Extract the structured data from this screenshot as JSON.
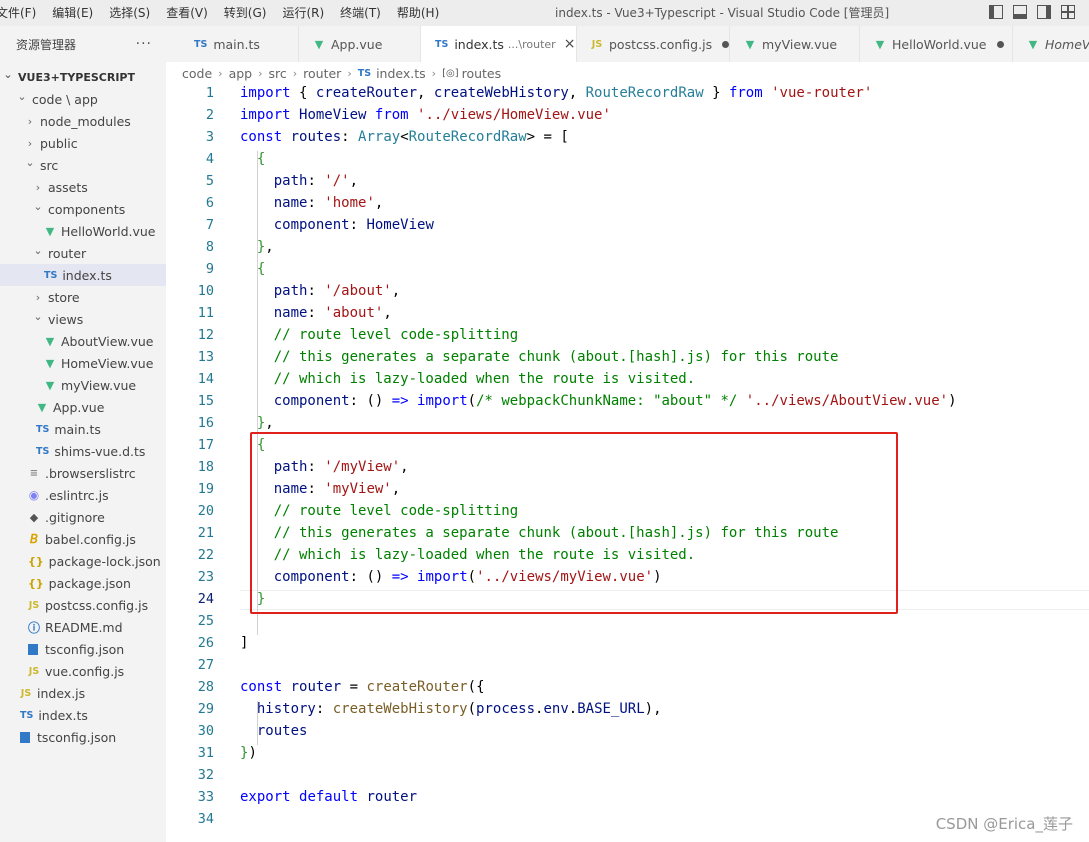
{
  "menu": [
    "文件(F)",
    "编辑(E)",
    "选择(S)",
    "查看(V)",
    "转到(G)",
    "运行(R)",
    "终端(T)",
    "帮助(H)"
  ],
  "window_title": "index.ts - Vue3+Typescript - Visual Studio Code [管理员]",
  "explorer": {
    "title": "资源管理器",
    "more": "···",
    "tree": [
      {
        "label": "VUE3+TYPESCRIPT",
        "icon": "chevron-down",
        "depth": 0,
        "root": true
      },
      {
        "label": "code \\ app",
        "icon": "chevron-down",
        "depth": 1
      },
      {
        "label": "node_modules",
        "icon": "chevron-right",
        "depth": 2
      },
      {
        "label": "public",
        "icon": "chevron-right",
        "depth": 2
      },
      {
        "label": "src",
        "icon": "chevron-down",
        "depth": 2
      },
      {
        "label": "assets",
        "icon": "chevron-right",
        "depth": 3
      },
      {
        "label": "components",
        "icon": "chevron-down",
        "depth": 3
      },
      {
        "label": "HelloWorld.vue",
        "icon": "vue",
        "depth": 4
      },
      {
        "label": "router",
        "icon": "chevron-down",
        "depth": 3
      },
      {
        "label": "index.ts",
        "icon": "ts",
        "depth": 4,
        "active": true
      },
      {
        "label": "store",
        "icon": "chevron-right",
        "depth": 3
      },
      {
        "label": "views",
        "icon": "chevron-down",
        "depth": 3
      },
      {
        "label": "AboutView.vue",
        "icon": "vue",
        "depth": 4
      },
      {
        "label": "HomeView.vue",
        "icon": "vue",
        "depth": 4
      },
      {
        "label": "myView.vue",
        "icon": "vue",
        "depth": 4
      },
      {
        "label": "App.vue",
        "icon": "vue",
        "depth": 3
      },
      {
        "label": "main.ts",
        "icon": "ts",
        "depth": 3
      },
      {
        "label": "shims-vue.d.ts",
        "icon": "ts",
        "depth": 3
      },
      {
        "label": ".browserslistrc",
        "icon": "dot",
        "depth": 2
      },
      {
        "label": ".eslintrc.js",
        "icon": "eslint",
        "depth": 2
      },
      {
        "label": ".gitignore",
        "icon": "git",
        "depth": 2
      },
      {
        "label": "babel.config.js",
        "icon": "babel",
        "depth": 2
      },
      {
        "label": "package-lock.json",
        "icon": "json",
        "depth": 2
      },
      {
        "label": "package.json",
        "icon": "json",
        "depth": 2
      },
      {
        "label": "postcss.config.js",
        "icon": "js",
        "depth": 2
      },
      {
        "label": "README.md",
        "icon": "info",
        "depth": 2
      },
      {
        "label": "tsconfig.json",
        "icon": "tsconfig",
        "depth": 2
      },
      {
        "label": "vue.config.js",
        "icon": "js",
        "depth": 2
      },
      {
        "label": "index.js",
        "icon": "js",
        "depth": 1
      },
      {
        "label": "index.ts",
        "icon": "ts",
        "depth": 1
      },
      {
        "label": "tsconfig.json",
        "icon": "tsconfig",
        "depth": 1
      }
    ]
  },
  "tabs": [
    {
      "label": "main.ts",
      "icon": "ts"
    },
    {
      "label": "App.vue",
      "icon": "vue"
    },
    {
      "label": "index.ts",
      "icon": "ts",
      "desc": "...\\router",
      "active": true
    },
    {
      "label": "postcss.config.js",
      "icon": "js",
      "dirty": true
    },
    {
      "label": "myView.vue",
      "icon": "vue"
    },
    {
      "label": "HelloWorld.vue",
      "icon": "vue",
      "dirty": true
    },
    {
      "label": "HomeV",
      "icon": "vue"
    }
  ],
  "breadcrumb": [
    "code",
    "app",
    "src",
    "router",
    "index.ts",
    "routes"
  ],
  "file_icon_text": {
    "ts": "TS",
    "js": "JS",
    "json": "{}",
    "vue": "▼",
    "babel": "𝘉",
    "eslint": "◉",
    "git": "◆",
    "info": "ⓘ",
    "dot": "≡"
  },
  "code_lines": [
    "import { createRouter, createWebHistory, RouteRecordRaw } from 'vue-router'",
    "import HomeView from '../views/HomeView.vue'",
    "const routes: Array<RouteRecordRaw> = [",
    "  {",
    "    path: '/',",
    "    name: 'home',",
    "    component: HomeView",
    "  },",
    "  {",
    "    path: '/about',",
    "    name: 'about',",
    "    // route level code-splitting",
    "    // this generates a separate chunk (about.[hash].js) for this route",
    "    // which is lazy-loaded when the route is visited.",
    "    component: () => import(/* webpackChunkName: \"about\" */ '../views/AboutView.vue')",
    "  },",
    "  {",
    "    path: '/myView',",
    "    name: 'myView',",
    "    // route level code-splitting",
    "    // this generates a separate chunk (about.[hash].js) for this route",
    "    // which is lazy-loaded when the route is visited.",
    "    component: () => import('../views/myView.vue')",
    "  }",
    "",
    "]",
    "",
    "const router = createRouter({",
    "  history: createWebHistory(process.env.BASE_URL),",
    "  routes",
    "})",
    "",
    "export default router",
    ""
  ],
  "current_line": 24,
  "watermark": "CSDN @Erica_莲子",
  "colors": {
    "highlight_box": "#e0201c",
    "keyword": "#0000ff",
    "string": "#a31515",
    "comment": "#008000"
  }
}
